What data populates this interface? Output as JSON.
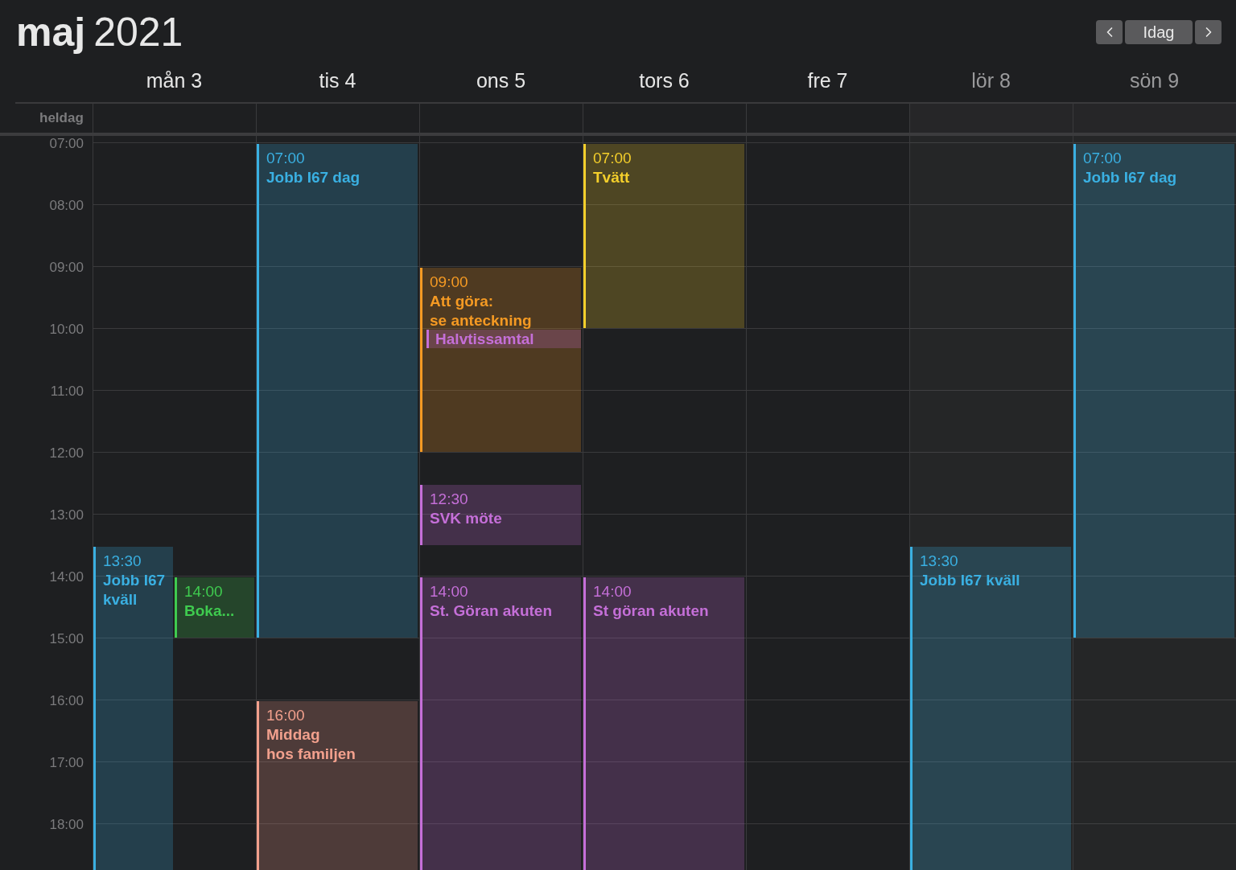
{
  "header": {
    "month": "maj",
    "year": "2021",
    "nav": {
      "today": "Idag"
    }
  },
  "all_day_label": "heldag",
  "hours": [
    "07:00",
    "08:00",
    "09:00",
    "10:00",
    "11:00",
    "12:00",
    "13:00",
    "14:00",
    "15:00",
    "16:00",
    "17:00",
    "18:00"
  ],
  "days": [
    {
      "label": "mån 3",
      "weekend": false,
      "events": [
        {
          "time": "13:30",
          "title": "Jobb I67 kväll",
          "color": "#3ab0e2"
        },
        {
          "time": "14:00",
          "title": "Boka...",
          "color": "#3fcb4f"
        }
      ]
    },
    {
      "label": "tis 4",
      "weekend": false,
      "events": [
        {
          "time": "07:00",
          "title": "Jobb I67 dag",
          "color": "#3ab0e2"
        },
        {
          "time": "16:00",
          "title": "Middag\nhos familjen",
          "color": "#f2a08d"
        }
      ]
    },
    {
      "label": "ons 5",
      "weekend": false,
      "events": [
        {
          "time": "09:00",
          "title": "Att göra:\nse anteckning",
          "color": "#f59a23"
        },
        {
          "title": "Halvtissamtal",
          "color": "#c56fd8"
        },
        {
          "time": "12:30",
          "title": "SVK möte",
          "color": "#c56fd8"
        },
        {
          "time": "14:00",
          "title": "St. Göran akuten",
          "color": "#c56fd8"
        }
      ]
    },
    {
      "label": "tors 6",
      "weekend": false,
      "events": [
        {
          "time": "07:00",
          "title": "Tvätt",
          "color": "#f4cf2b"
        },
        {
          "time": "14:00",
          "title": "St göran akuten",
          "color": "#c56fd8"
        }
      ]
    },
    {
      "label": "fre 7",
      "weekend": false
    },
    {
      "label": "lör 8",
      "weekend": true,
      "events": [
        {
          "time": "13:30",
          "title": "Jobb I67 kväll",
          "color": "#3ab0e2"
        }
      ]
    },
    {
      "label": "sön 9",
      "weekend": true,
      "events": [
        {
          "time": "07:00",
          "title": "Jobb I67 dag",
          "color": "#3ab0e2"
        }
      ]
    }
  ]
}
